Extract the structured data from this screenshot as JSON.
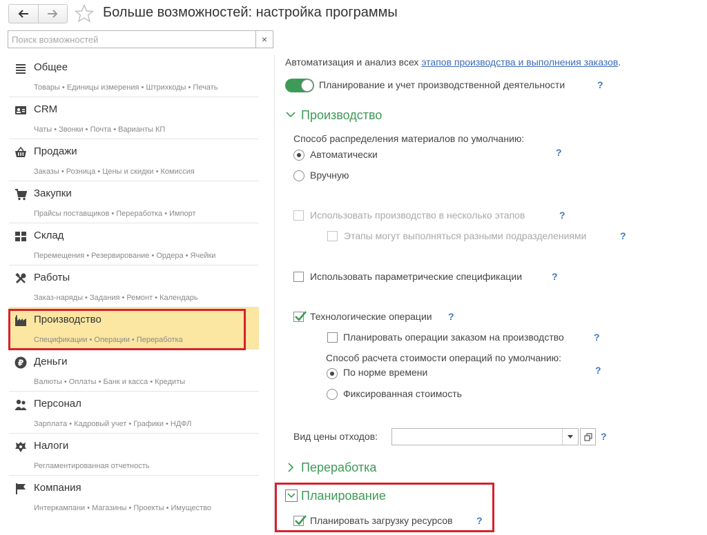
{
  "header": {
    "title": "Больше возможностей: настройка программы",
    "back_icon": "arrow-left-icon",
    "forward_icon": "arrow-right-icon",
    "favorite_icon": "star-outline-icon"
  },
  "search": {
    "placeholder": "Поиск возможностей",
    "value": "",
    "clear_label": "×"
  },
  "sidebar": {
    "selected": "Производство",
    "highlight_color": "#fbe6a2",
    "categories": [
      {
        "label": "Общее",
        "subtitle": "Товары • Единицы измерения • Штрихкоды • Печать",
        "icon": "list-icon"
      },
      {
        "label": "CRM",
        "subtitle": "Чаты • Звонки • Почта • Варианты КП",
        "icon": "contact-card-icon"
      },
      {
        "label": "Продажи",
        "subtitle": "Заказы • Розница • Цены и скидки • Комиссия",
        "icon": "basket-icon"
      },
      {
        "label": "Закупки",
        "subtitle": "Прайсы поставщиков • Переработка • Импорт",
        "icon": "cart-icon"
      },
      {
        "label": "Склад",
        "subtitle": "Перемещения • Резервирование • Ордера • Ячейки",
        "icon": "warehouse-icon"
      },
      {
        "label": "Работы",
        "subtitle": "Заказ-наряды • Задания • Ремонт • Календарь",
        "icon": "tools-icon"
      },
      {
        "label": "Производство",
        "subtitle": "Спецификации • Операции • Переработка",
        "icon": "factory-icon"
      },
      {
        "label": "Деньги",
        "subtitle": "Валюты • Оплаты • Банк и касса • Кредиты",
        "icon": "ruble-icon"
      },
      {
        "label": "Персонал",
        "subtitle": "Зарплата • Кадровый учет • Графики • НДФЛ",
        "icon": "people-icon"
      },
      {
        "label": "Налоги",
        "subtitle": "Регламентированная отчетность",
        "icon": "emblem-icon"
      },
      {
        "label": "Компания",
        "subtitle": "Интеркампани • Магазины • Проекты • Имущество",
        "icon": "flag-icon"
      }
    ]
  },
  "main": {
    "intro_text": "Автоматизация и анализ всех",
    "intro_link": "этапов производства и выполнения заказов",
    "intro_end": ".",
    "toggle_label": "Планирование и учет производственной деятельности",
    "toggle_on": true,
    "accent_color": "#3d9a57",
    "help": "?",
    "production": {
      "title": "Производство",
      "expanded": true,
      "material_dist_label": "Способ распределения материалов по умолчанию:",
      "radio_auto": "Автоматически",
      "radio_manual": "Вручную",
      "multistage_label": "Использовать производство в несколько этапов",
      "multistage_checked": false,
      "stages_label": "Этапы могут выполняться разными подразделениями",
      "stages_checked": false,
      "parametric_label": "Использовать параметрические спецификации",
      "parametric_checked": false,
      "tech_ops_label": "Технологические операции",
      "tech_ops_checked": true,
      "plan_ops_label": "Планировать операции заказом на производство",
      "plan_ops_checked": false,
      "cost_method_label": "Способ расчета стоимости операций по умолчанию:",
      "radio_norm": "По норме времени",
      "radio_fixed": "Фиксированная стоимость",
      "waste_price_label": "Вид цены отходов:",
      "waste_price_value": ""
    },
    "processing": {
      "title": "Переработка",
      "expanded": false
    },
    "planning": {
      "title": "Планирование",
      "expanded": true,
      "resource_label": "Планировать загрузку ресурсов",
      "resource_checked": true
    }
  },
  "annotations": {
    "outline_color": "#d7202c"
  }
}
